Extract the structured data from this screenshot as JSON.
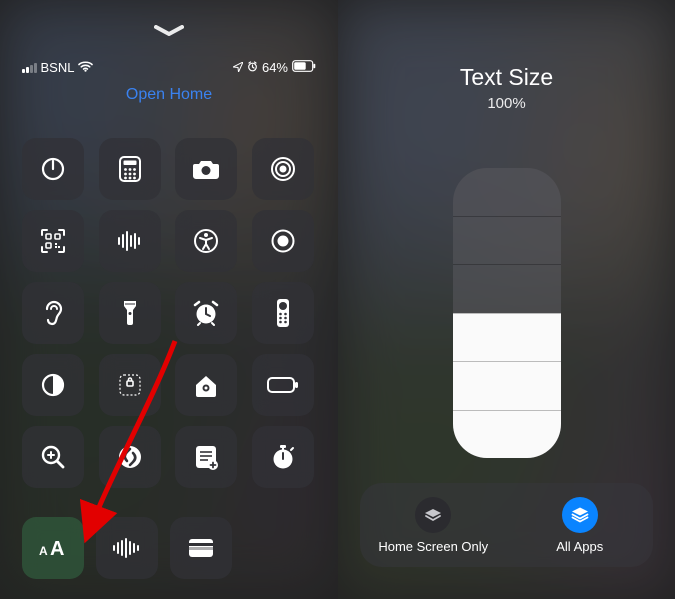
{
  "left": {
    "status": {
      "carrier": "BSNL",
      "battery_pct": "64%"
    },
    "open_home": "Open Home",
    "tiles": [
      {
        "name": "timer-icon"
      },
      {
        "name": "calculator-icon"
      },
      {
        "name": "camera-icon"
      },
      {
        "name": "airdrop-icon"
      },
      {
        "name": "qr-scanner-icon"
      },
      {
        "name": "voice-memo-icon"
      },
      {
        "name": "accessibility-icon"
      },
      {
        "name": "screen-record-icon"
      },
      {
        "name": "hearing-icon"
      },
      {
        "name": "flashlight-icon"
      },
      {
        "name": "alarm-icon"
      },
      {
        "name": "apple-tv-remote-icon"
      },
      {
        "name": "dark-mode-icon"
      },
      {
        "name": "guided-access-icon"
      },
      {
        "name": "home-icon"
      },
      {
        "name": "low-power-icon"
      },
      {
        "name": "magnifier-icon"
      },
      {
        "name": "shazam-icon"
      },
      {
        "name": "notes-icon"
      },
      {
        "name": "stopwatch-icon"
      }
    ],
    "bottom_tiles": [
      {
        "name": "text-size-icon"
      },
      {
        "name": "sound-recognition-icon"
      },
      {
        "name": "wallet-icon"
      }
    ]
  },
  "right": {
    "title": "Text Size",
    "percent": "100%",
    "slider_segments": 6,
    "slider_active_from": 3,
    "buttons": {
      "home_only": "Home Screen Only",
      "all_apps": "All Apps"
    }
  }
}
